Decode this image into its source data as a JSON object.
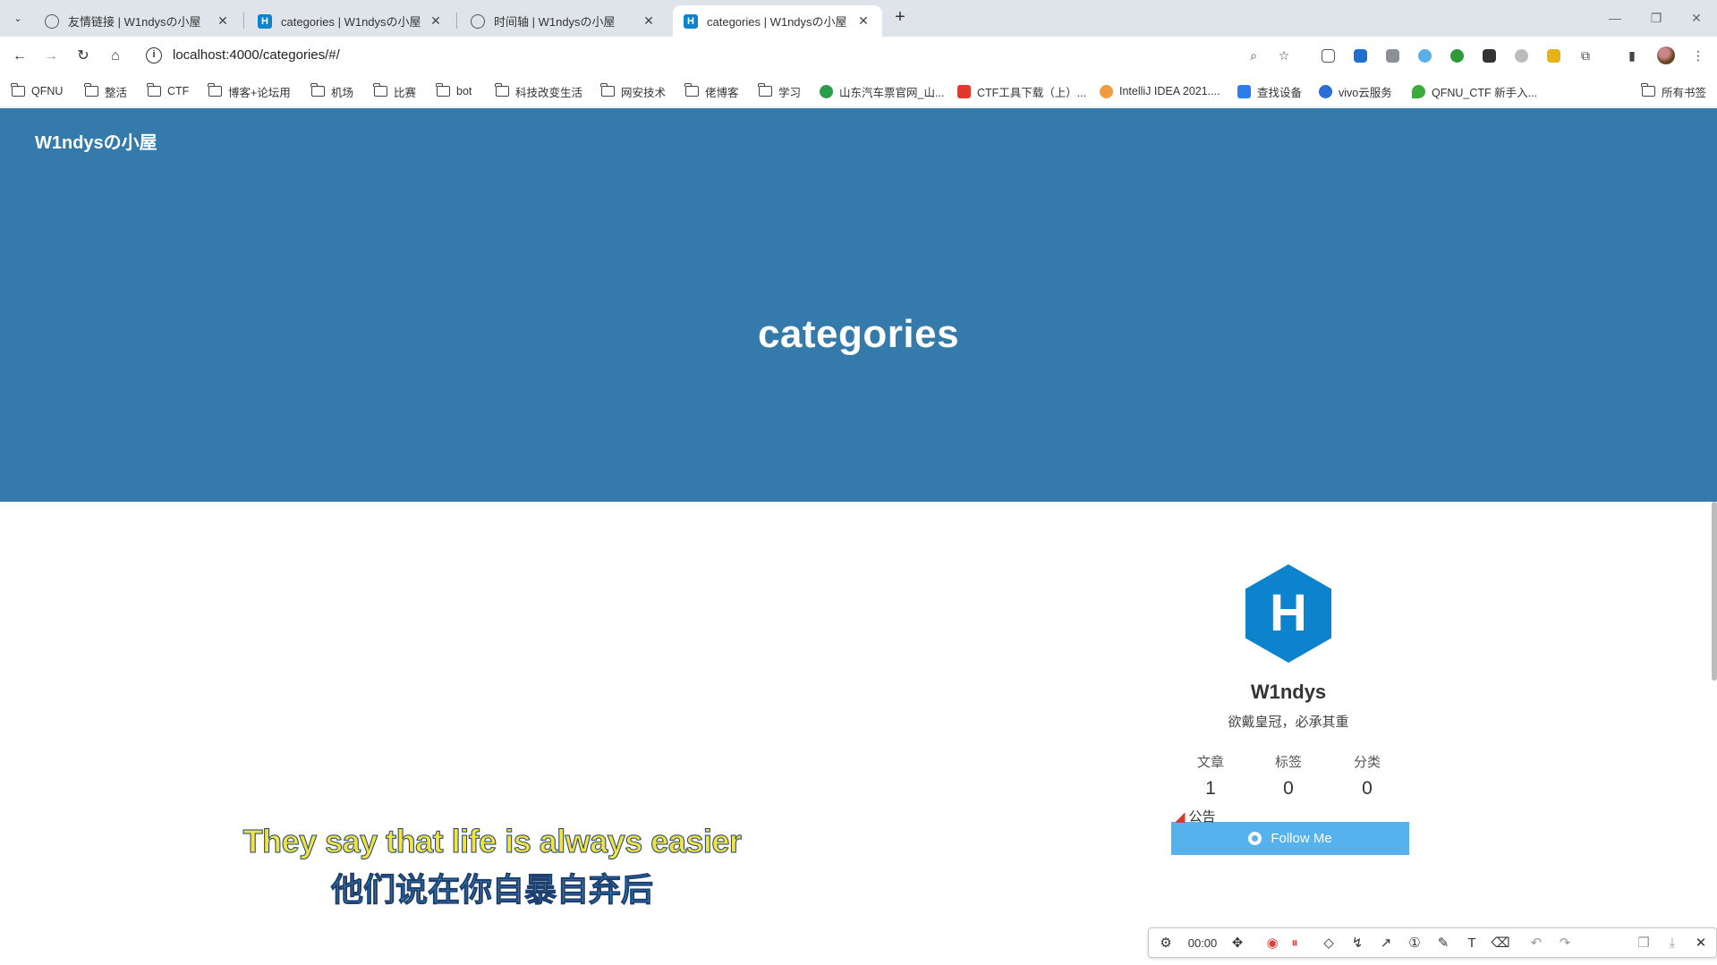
{
  "browser": {
    "tabs": [
      {
        "title": "友情链接 | W1ndysの小屋",
        "favicon": "globe-icon",
        "active": false
      },
      {
        "title": "categories | W1ndysの小屋",
        "favicon": "hexo-icon",
        "active": false
      },
      {
        "title": "时间轴 | W1ndysの小屋",
        "favicon": "globe-icon",
        "active": false
      },
      {
        "title": "categories | W1ndysの小屋",
        "favicon": "hexo-icon",
        "active": true
      }
    ],
    "url": "localhost:4000/categories/#/",
    "bookmarks": [
      {
        "label": "QFNU",
        "icon": "folder-icon"
      },
      {
        "label": "整活",
        "icon": "folder-icon"
      },
      {
        "label": "CTF",
        "icon": "folder-icon"
      },
      {
        "label": "博客+论坛用",
        "icon": "folder-icon"
      },
      {
        "label": "机场",
        "icon": "folder-icon"
      },
      {
        "label": "比赛",
        "icon": "folder-icon"
      },
      {
        "label": "bot",
        "icon": "folder-icon"
      },
      {
        "label": "科技改变生活",
        "icon": "folder-icon"
      },
      {
        "label": "网安技术",
        "icon": "folder-icon"
      },
      {
        "label": "佬博客",
        "icon": "folder-icon"
      },
      {
        "label": "学习",
        "icon": "folder-icon"
      },
      {
        "label": "山东汽车票官网_山...",
        "icon": "site-icon",
        "color": "#2a9d4a"
      },
      {
        "label": "CTF工具下载（上）...",
        "icon": "site-icon",
        "color": "#e03a2f"
      },
      {
        "label": "IntelliJ IDEA 2021....",
        "icon": "site-icon",
        "color": "#f29a3e"
      },
      {
        "label": "查找设备",
        "icon": "site-icon",
        "color": "#2b7de9"
      },
      {
        "label": "vivo云服务",
        "icon": "site-icon",
        "color": "#2b6fd6"
      },
      {
        "label": "QFNU_CTF 新手入...",
        "icon": "site-icon",
        "color": "#3cab3c"
      }
    ],
    "all_bookmarks": "所有书签"
  },
  "page": {
    "site_title": "W1ndysの小屋",
    "heading": "categories",
    "banner_color": "#347aab",
    "profile": {
      "author": "W1ndys",
      "motto": "欲戴皇冠，必承其重",
      "stats": [
        {
          "label": "文章",
          "value": "1"
        },
        {
          "label": "标签",
          "value": "0"
        },
        {
          "label": "分类",
          "value": "0"
        }
      ],
      "follow_label": "Follow Me",
      "logo_letter": "H",
      "logo_color": "#0e83cd"
    },
    "announcement": "公告"
  },
  "subtitle": {
    "en": "They say that life is always easier",
    "zh": "他们说在你自暴自弃后"
  },
  "capture_toolbar": {
    "timer": "00:00"
  }
}
